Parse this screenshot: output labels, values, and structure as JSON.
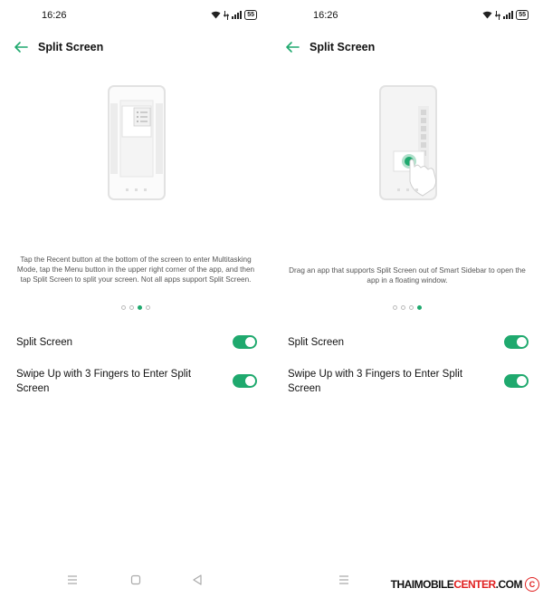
{
  "colors": {
    "accent": "#1fa96e",
    "toggle_on": "#1fa96e",
    "watermark_red": "#e02020"
  },
  "screens": [
    {
      "status": {
        "time": "16:26",
        "battery": "55",
        "icons": [
          "wifi-icon",
          "data-arrows-icon",
          "signal-icon",
          "battery-icon"
        ]
      },
      "header": {
        "title": "Split Screen"
      },
      "illustration": "phone-recent-apps-illustration",
      "description": "Tap the Recent button at the bottom of the screen to enter Multitasking Mode, tap the Menu button in the upper right corner of the app, and then tap Split Screen to split your screen. Not all apps support Split Screen.",
      "pager": {
        "count": 4,
        "active_index": 2
      },
      "settings": [
        {
          "label": "Split Screen",
          "enabled": true
        },
        {
          "label": "Swipe Up with 3 Fingers to Enter Split Screen",
          "enabled": true
        }
      ]
    },
    {
      "status": {
        "time": "16:26",
        "battery": "55",
        "icons": [
          "wifi-icon",
          "data-arrows-icon",
          "signal-icon",
          "battery-icon"
        ]
      },
      "header": {
        "title": "Split Screen"
      },
      "illustration": "phone-smart-sidebar-drag-illustration",
      "description": "Drag an app that supports Split Screen out of Smart Sidebar to open the app in a floating window.",
      "pager": {
        "count": 4,
        "active_index": 3
      },
      "settings": [
        {
          "label": "Split Screen",
          "enabled": true
        },
        {
          "label": "Swipe Up with 3 Fingers to Enter Split Screen",
          "enabled": true
        }
      ]
    }
  ],
  "watermark": {
    "part1": "THAIMOBILE",
    "part2": "CENTER",
    "part3": ".COM",
    "symbol": "C"
  }
}
